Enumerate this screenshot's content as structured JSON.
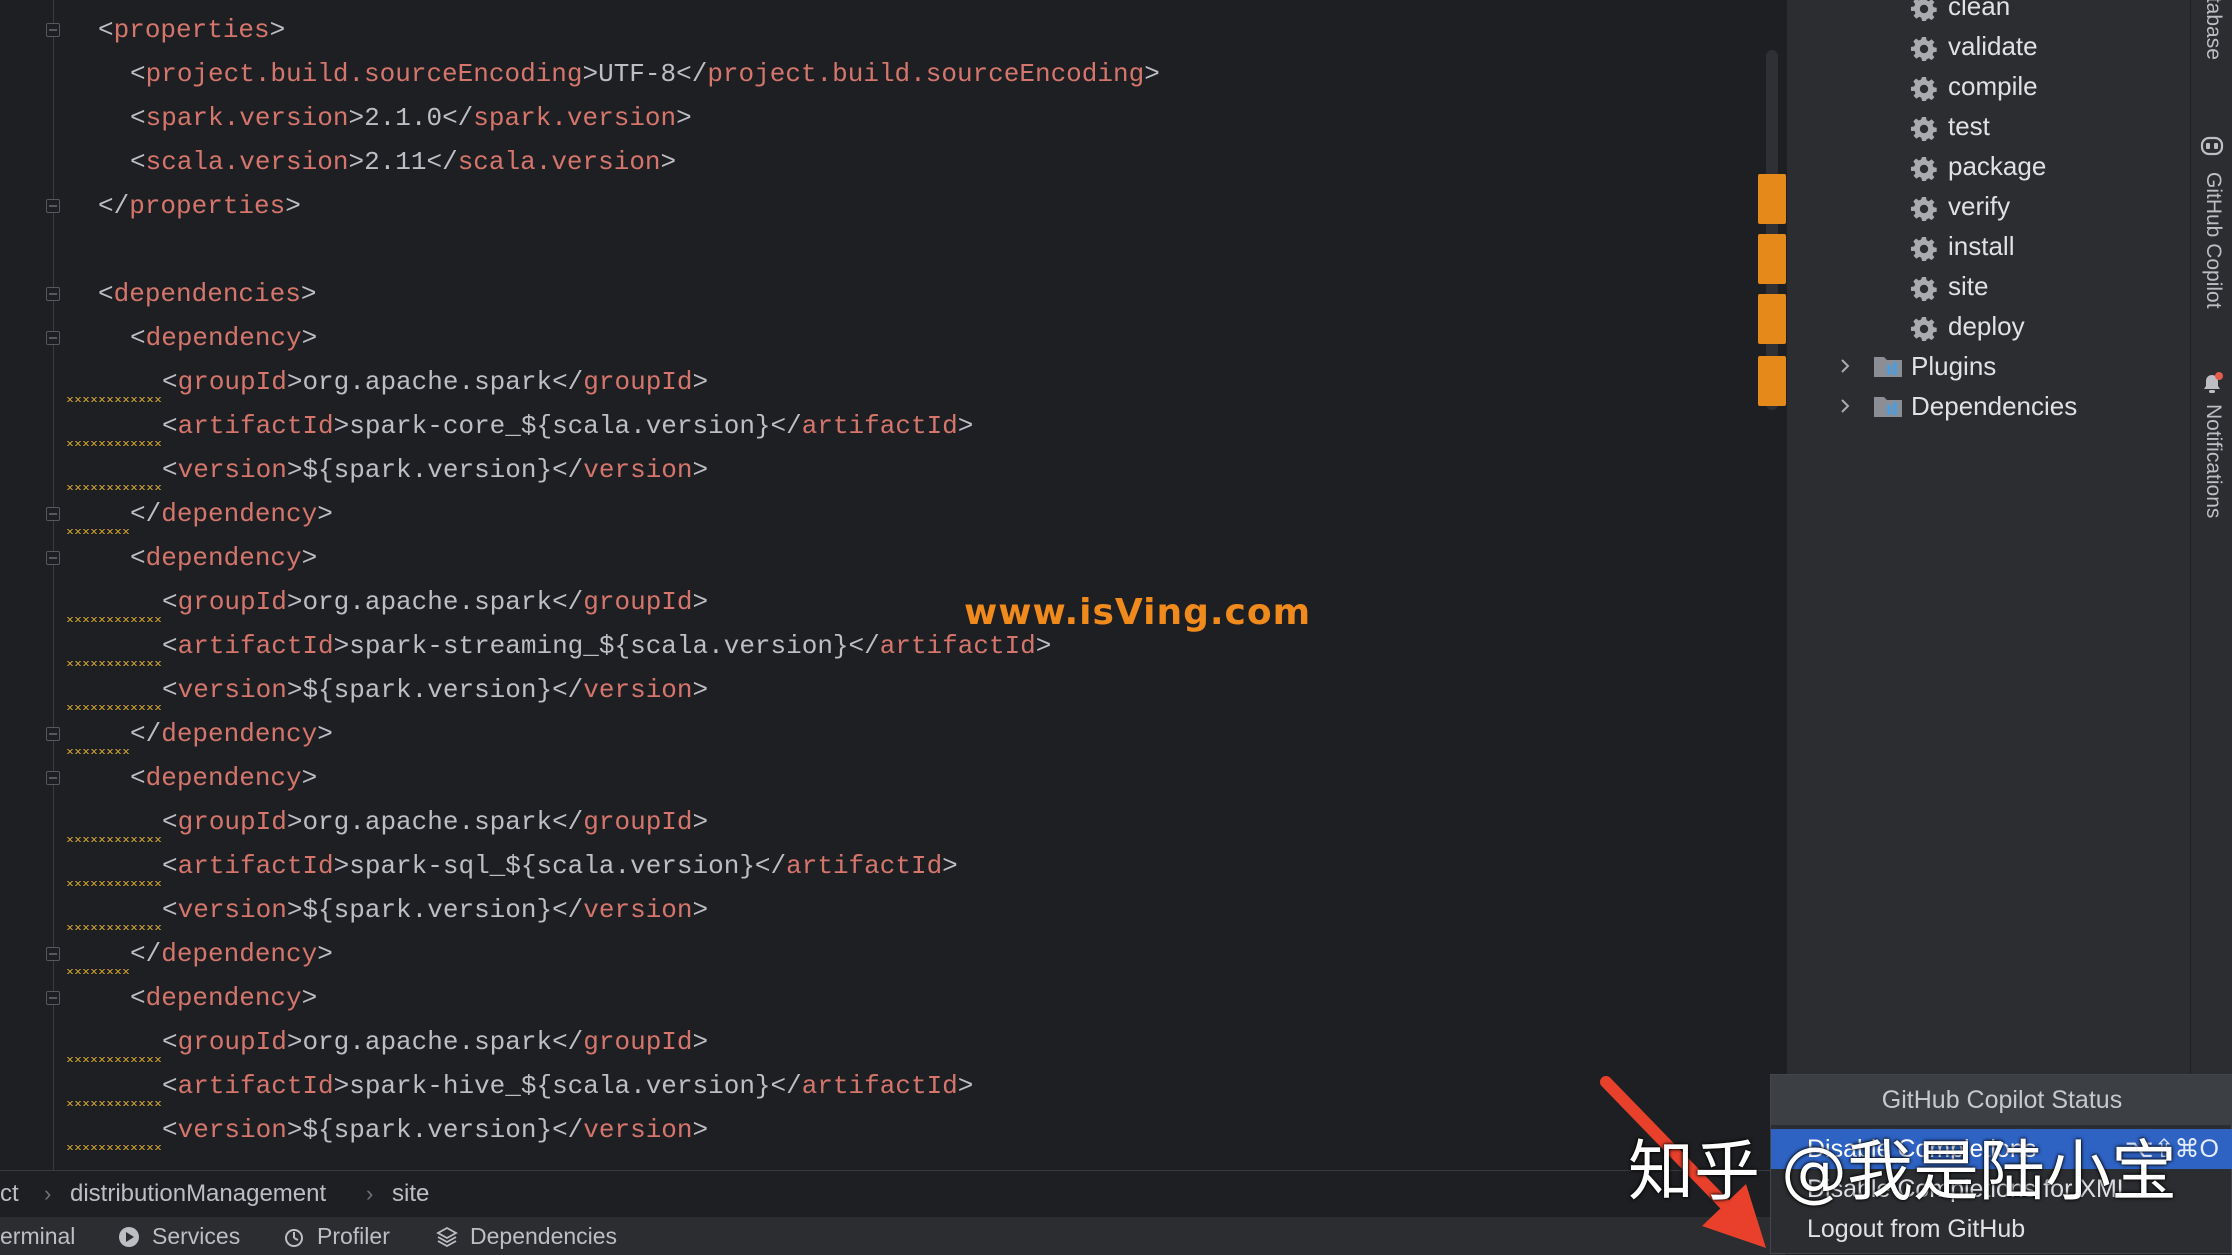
{
  "editor": {
    "lines": [
      {
        "indent": 0,
        "kind": "open",
        "tag": "properties"
      },
      {
        "indent": 1,
        "kind": "elem",
        "tag": "project.build.sourceEncoding",
        "value": "UTF-8"
      },
      {
        "indent": 1,
        "kind": "elem",
        "tag": "spark.version",
        "value": "2.1.0"
      },
      {
        "indent": 1,
        "kind": "elem",
        "tag": "scala.version",
        "value": "2.11"
      },
      {
        "indent": 0,
        "kind": "close",
        "tag": "properties"
      },
      {
        "indent": 0,
        "kind": "blank"
      },
      {
        "indent": 0,
        "kind": "open",
        "tag": "dependencies"
      },
      {
        "indent": 1,
        "kind": "open",
        "tag": "dependency",
        "warn": true
      },
      {
        "indent": 2,
        "kind": "elem",
        "tag": "groupId",
        "value": "org.apache.spark",
        "warn": true
      },
      {
        "indent": 2,
        "kind": "elem",
        "tag": "artifactId",
        "value": "spark-core_${scala.version}",
        "warn": true
      },
      {
        "indent": 2,
        "kind": "elem",
        "tag": "version",
        "value": "${spark.version}",
        "warn": true
      },
      {
        "indent": 1,
        "kind": "close",
        "tag": "dependency",
        "warn": true
      },
      {
        "indent": 1,
        "kind": "open",
        "tag": "dependency",
        "warn": true
      },
      {
        "indent": 2,
        "kind": "elem",
        "tag": "groupId",
        "value": "org.apache.spark",
        "warn": true
      },
      {
        "indent": 2,
        "kind": "elem",
        "tag": "artifactId",
        "value": "spark-streaming_${scala.version}",
        "warn": true
      },
      {
        "indent": 2,
        "kind": "elem",
        "tag": "version",
        "value": "${spark.version}",
        "warn": true
      },
      {
        "indent": 1,
        "kind": "close",
        "tag": "dependency",
        "warn": true
      },
      {
        "indent": 1,
        "kind": "open",
        "tag": "dependency",
        "warn": true
      },
      {
        "indent": 2,
        "kind": "elem",
        "tag": "groupId",
        "value": "org.apache.spark",
        "warn": true
      },
      {
        "indent": 2,
        "kind": "elem",
        "tag": "artifactId",
        "value": "spark-sql_${scala.version}",
        "warn": true
      },
      {
        "indent": 2,
        "kind": "elem",
        "tag": "version",
        "value": "${spark.version}",
        "warn": true
      },
      {
        "indent": 1,
        "kind": "close",
        "tag": "dependency",
        "warn": true
      },
      {
        "indent": 1,
        "kind": "open",
        "tag": "dependency",
        "warn": true
      },
      {
        "indent": 2,
        "kind": "elem",
        "tag": "groupId",
        "value": "org.apache.spark",
        "warn": true
      },
      {
        "indent": 2,
        "kind": "elem",
        "tag": "artifactId",
        "value": "spark-hive_${scala.version}",
        "warn": true
      },
      {
        "indent": 2,
        "kind": "elem",
        "tag": "version",
        "value": "${spark.version}",
        "warn": true
      }
    ],
    "watermark": "www.isVing.com"
  },
  "maven": {
    "lifecycle": [
      "clean",
      "validate",
      "compile",
      "test",
      "package",
      "verify",
      "install",
      "site",
      "deploy"
    ],
    "tree": [
      {
        "label": "Plugins",
        "icon": "plugins-folder-icon"
      },
      {
        "label": "Dependencies",
        "icon": "dependencies-folder-icon"
      }
    ]
  },
  "right_strip": {
    "database": "Database",
    "copilot": "GitHub Copilot",
    "notifications": "Notifications"
  },
  "breadcrumb": [
    "ct",
    "distributionManagement",
    "site"
  ],
  "bottom_tabs": [
    {
      "label": "erminal"
    },
    {
      "label": "Services",
      "icon": "services-icon"
    },
    {
      "label": "Profiler",
      "icon": "profiler-icon"
    },
    {
      "label": "Dependencies",
      "icon": "dependencies-icon"
    }
  ],
  "popup": {
    "title": "GitHub Copilot Status",
    "items": [
      {
        "label": "Disable Completions",
        "shortcut": "⌥⇧⌘O",
        "selected": true
      },
      {
        "label": "Disable Completions for XML"
      },
      {
        "label": "Logout from GitHub"
      }
    ]
  },
  "overlay": {
    "zhihu": "知乎 @我是陆小宝"
  },
  "colors": {
    "tag": "#d5756c",
    "text": "#bcbec4",
    "warning": "#c39a2a",
    "selection": "#2e63c4",
    "marker": "#e58a1a"
  }
}
